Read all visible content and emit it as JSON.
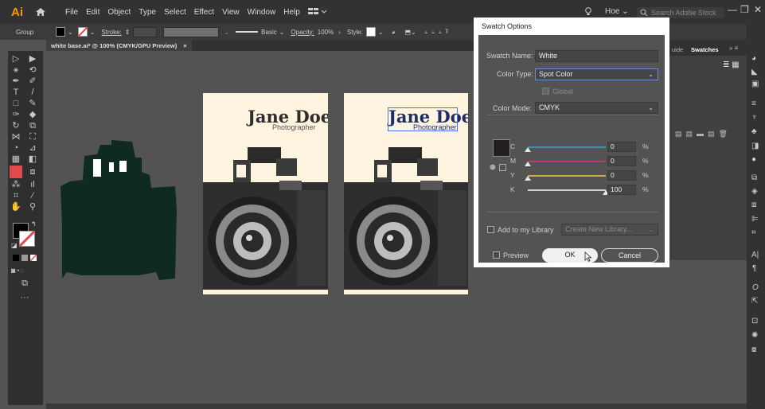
{
  "app": {
    "logo": "Ai",
    "menu": [
      "File",
      "Edit",
      "Object",
      "Type",
      "Select",
      "Effect",
      "View",
      "Window",
      "Help"
    ],
    "user": "Hoe",
    "search_placeholder": "Search Adobe Stock"
  },
  "control_bar": {
    "selection": "Group",
    "stroke_label": "Stroke:",
    "brush": "Basic",
    "opacity_label": "Opacity:",
    "opacity_value": "100%",
    "style_label": "Style:"
  },
  "document": {
    "tab_title": "white base.ai* @ 100% (CMYK/GPU Preview)",
    "close": "×"
  },
  "artboards": [
    {
      "name": "Jane Doe",
      "subtitle": "Photographer"
    },
    {
      "name": "Jane Doe",
      "subtitle": "Photographer"
    }
  ],
  "panels": {
    "tab_guide": "uide",
    "tab_swatches": "Swatches"
  },
  "dialog": {
    "title": "Swatch Options",
    "swatch_name_label": "Swatch Name:",
    "swatch_name_value": "White",
    "color_type_label": "Color Type:",
    "color_type_value": "Spot Color",
    "global_label": "Global",
    "color_mode_label": "Color Mode:",
    "color_mode_value": "CMYK",
    "channels": [
      {
        "label": "C",
        "value": "0",
        "unit": "%",
        "level": 0,
        "color": "#3a8fb7"
      },
      {
        "label": "M",
        "value": "0",
        "unit": "%",
        "level": 0,
        "color": "#b73a7a"
      },
      {
        "label": "Y",
        "value": "0",
        "unit": "%",
        "level": 0,
        "color": "#c8b23a"
      },
      {
        "label": "K",
        "value": "100",
        "unit": "%",
        "level": 1,
        "color": "#d0d0d0"
      }
    ],
    "add_library_label": "Add to my Library",
    "library_placeholder": "Create New Library...",
    "preview_label": "Preview",
    "ok_label": "OK",
    "cancel_label": "Cancel"
  },
  "colors": {
    "silhouette": "#0f2a20",
    "artboard": "#fff4df",
    "accent_red": "#e04b4b",
    "selection_blue": "#4a6cff",
    "app_orange": "#ff9a00"
  }
}
